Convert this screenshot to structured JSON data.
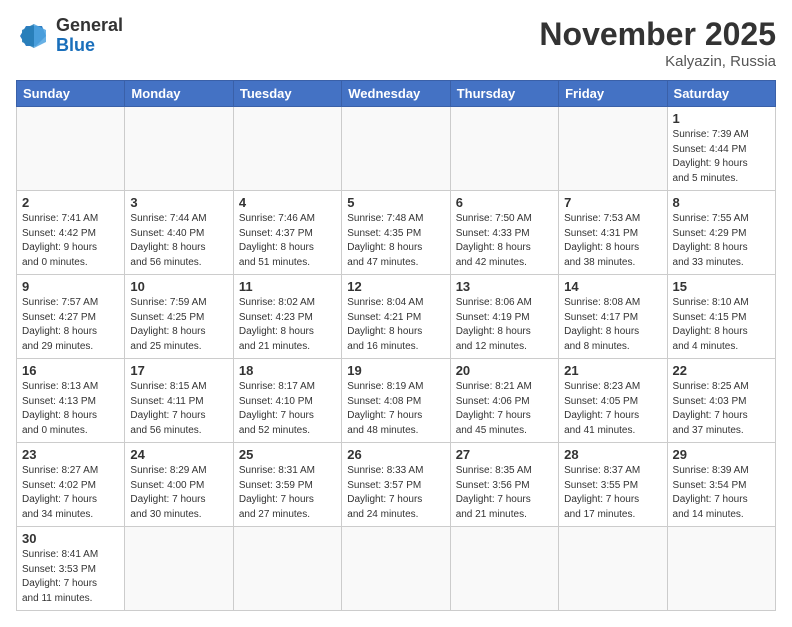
{
  "header": {
    "logo_general": "General",
    "logo_blue": "Blue",
    "month_title": "November 2025",
    "location": "Kalyazin, Russia"
  },
  "weekdays": [
    "Sunday",
    "Monday",
    "Tuesday",
    "Wednesday",
    "Thursday",
    "Friday",
    "Saturday"
  ],
  "weeks": [
    [
      {
        "day": "",
        "info": ""
      },
      {
        "day": "",
        "info": ""
      },
      {
        "day": "",
        "info": ""
      },
      {
        "day": "",
        "info": ""
      },
      {
        "day": "",
        "info": ""
      },
      {
        "day": "",
        "info": ""
      },
      {
        "day": "1",
        "info": "Sunrise: 7:39 AM\nSunset: 4:44 PM\nDaylight: 9 hours\nand 5 minutes."
      }
    ],
    [
      {
        "day": "2",
        "info": "Sunrise: 7:41 AM\nSunset: 4:42 PM\nDaylight: 9 hours\nand 0 minutes."
      },
      {
        "day": "3",
        "info": "Sunrise: 7:44 AM\nSunset: 4:40 PM\nDaylight: 8 hours\nand 56 minutes."
      },
      {
        "day": "4",
        "info": "Sunrise: 7:46 AM\nSunset: 4:37 PM\nDaylight: 8 hours\nand 51 minutes."
      },
      {
        "day": "5",
        "info": "Sunrise: 7:48 AM\nSunset: 4:35 PM\nDaylight: 8 hours\nand 47 minutes."
      },
      {
        "day": "6",
        "info": "Sunrise: 7:50 AM\nSunset: 4:33 PM\nDaylight: 8 hours\nand 42 minutes."
      },
      {
        "day": "7",
        "info": "Sunrise: 7:53 AM\nSunset: 4:31 PM\nDaylight: 8 hours\nand 38 minutes."
      },
      {
        "day": "8",
        "info": "Sunrise: 7:55 AM\nSunset: 4:29 PM\nDaylight: 8 hours\nand 33 minutes."
      }
    ],
    [
      {
        "day": "9",
        "info": "Sunrise: 7:57 AM\nSunset: 4:27 PM\nDaylight: 8 hours\nand 29 minutes."
      },
      {
        "day": "10",
        "info": "Sunrise: 7:59 AM\nSunset: 4:25 PM\nDaylight: 8 hours\nand 25 minutes."
      },
      {
        "day": "11",
        "info": "Sunrise: 8:02 AM\nSunset: 4:23 PM\nDaylight: 8 hours\nand 21 minutes."
      },
      {
        "day": "12",
        "info": "Sunrise: 8:04 AM\nSunset: 4:21 PM\nDaylight: 8 hours\nand 16 minutes."
      },
      {
        "day": "13",
        "info": "Sunrise: 8:06 AM\nSunset: 4:19 PM\nDaylight: 8 hours\nand 12 minutes."
      },
      {
        "day": "14",
        "info": "Sunrise: 8:08 AM\nSunset: 4:17 PM\nDaylight: 8 hours\nand 8 minutes."
      },
      {
        "day": "15",
        "info": "Sunrise: 8:10 AM\nSunset: 4:15 PM\nDaylight: 8 hours\nand 4 minutes."
      }
    ],
    [
      {
        "day": "16",
        "info": "Sunrise: 8:13 AM\nSunset: 4:13 PM\nDaylight: 8 hours\nand 0 minutes."
      },
      {
        "day": "17",
        "info": "Sunrise: 8:15 AM\nSunset: 4:11 PM\nDaylight: 7 hours\nand 56 minutes."
      },
      {
        "day": "18",
        "info": "Sunrise: 8:17 AM\nSunset: 4:10 PM\nDaylight: 7 hours\nand 52 minutes."
      },
      {
        "day": "19",
        "info": "Sunrise: 8:19 AM\nSunset: 4:08 PM\nDaylight: 7 hours\nand 48 minutes."
      },
      {
        "day": "20",
        "info": "Sunrise: 8:21 AM\nSunset: 4:06 PM\nDaylight: 7 hours\nand 45 minutes."
      },
      {
        "day": "21",
        "info": "Sunrise: 8:23 AM\nSunset: 4:05 PM\nDaylight: 7 hours\nand 41 minutes."
      },
      {
        "day": "22",
        "info": "Sunrise: 8:25 AM\nSunset: 4:03 PM\nDaylight: 7 hours\nand 37 minutes."
      }
    ],
    [
      {
        "day": "23",
        "info": "Sunrise: 8:27 AM\nSunset: 4:02 PM\nDaylight: 7 hours\nand 34 minutes."
      },
      {
        "day": "24",
        "info": "Sunrise: 8:29 AM\nSunset: 4:00 PM\nDaylight: 7 hours\nand 30 minutes."
      },
      {
        "day": "25",
        "info": "Sunrise: 8:31 AM\nSunset: 3:59 PM\nDaylight: 7 hours\nand 27 minutes."
      },
      {
        "day": "26",
        "info": "Sunrise: 8:33 AM\nSunset: 3:57 PM\nDaylight: 7 hours\nand 24 minutes."
      },
      {
        "day": "27",
        "info": "Sunrise: 8:35 AM\nSunset: 3:56 PM\nDaylight: 7 hours\nand 21 minutes."
      },
      {
        "day": "28",
        "info": "Sunrise: 8:37 AM\nSunset: 3:55 PM\nDaylight: 7 hours\nand 17 minutes."
      },
      {
        "day": "29",
        "info": "Sunrise: 8:39 AM\nSunset: 3:54 PM\nDaylight: 7 hours\nand 14 minutes."
      }
    ],
    [
      {
        "day": "30",
        "info": "Sunrise: 8:41 AM\nSunset: 3:53 PM\nDaylight: 7 hours\nand 11 minutes."
      },
      {
        "day": "",
        "info": ""
      },
      {
        "day": "",
        "info": ""
      },
      {
        "day": "",
        "info": ""
      },
      {
        "day": "",
        "info": ""
      },
      {
        "day": "",
        "info": ""
      },
      {
        "day": "",
        "info": ""
      }
    ]
  ],
  "colors": {
    "header_bg": "#4472C4",
    "accent_blue": "#1a6fbb"
  }
}
